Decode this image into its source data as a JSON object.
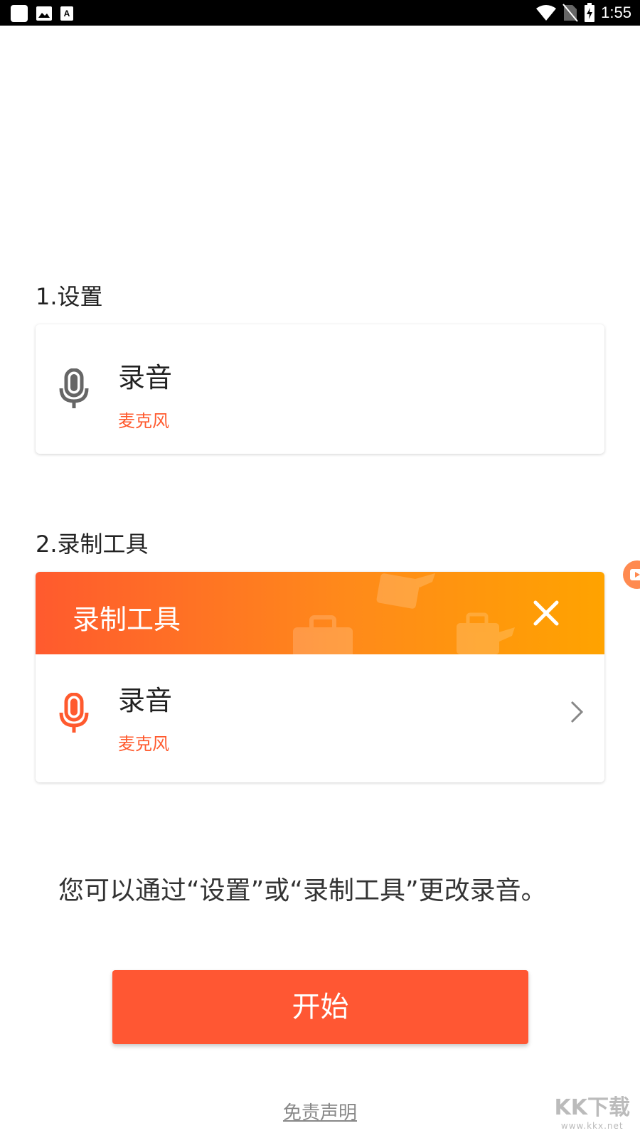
{
  "status_bar": {
    "time": "1:55",
    "left_icons": [
      "app-icon",
      "image-icon",
      "font-icon"
    ],
    "right_icons": [
      "wifi-icon",
      "no-sim-icon",
      "battery-charging-icon"
    ]
  },
  "section1": {
    "title": "1.设置",
    "item": {
      "title": "录音",
      "subtitle": "麦克风",
      "icon": "microphone-icon"
    }
  },
  "section2": {
    "title": "2.录制工具",
    "header_title": "录制工具",
    "item": {
      "title": "录音",
      "subtitle": "麦克风",
      "icon": "microphone-icon"
    }
  },
  "hint": "您可以通过“设置”或“录制工具”更改录音。",
  "start_button": "开始",
  "disclaimer": "免责声明",
  "watermark": {
    "main": "KK下载",
    "sub": "www.kkx.net"
  },
  "colors": {
    "accent": "#ff5733",
    "subtitle": "#ff5a2e",
    "gradient_start": "#ff5a2e",
    "gradient_end": "#ffa300",
    "gray_icon": "#666666"
  }
}
